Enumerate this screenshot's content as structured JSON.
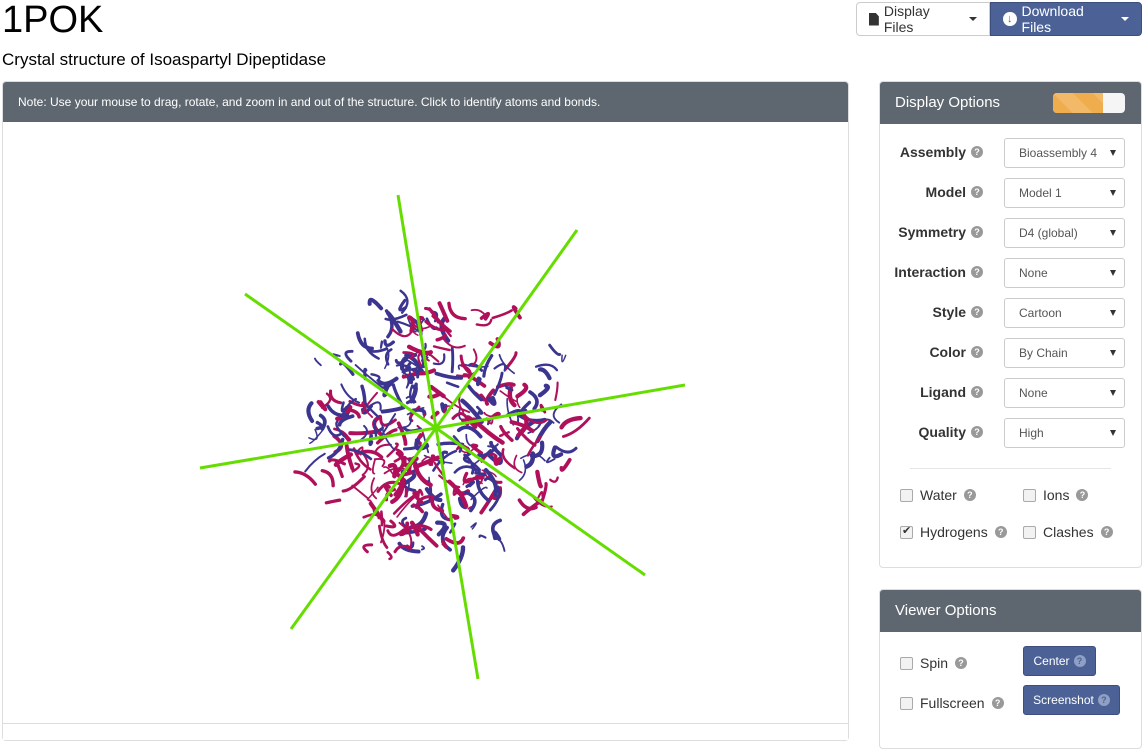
{
  "header": {
    "title": "1POK",
    "subtitle": "Crystal structure of Isoaspartyl Dipeptidase",
    "display_files_label": "Display Files",
    "download_files_label": "Download Files"
  },
  "viewer": {
    "note": "Note: Use your mouse to drag, rotate, and zoom in and out of the structure. Click to identify atoms and bonds.",
    "structure_colors": {
      "chain_a": "#3b3590",
      "chain_b": "#b0105a",
      "symmetry_axes": "#66dd00"
    }
  },
  "display_options": {
    "title": "Display Options",
    "loading_progress_percent": 70,
    "rows": [
      {
        "label": "Assembly",
        "value": "Bioassembly 4"
      },
      {
        "label": "Model",
        "value": "Model 1"
      },
      {
        "label": "Symmetry",
        "value": "D4 (global)"
      },
      {
        "label": "Interaction",
        "value": "None"
      },
      {
        "label": "Style",
        "value": "Cartoon"
      },
      {
        "label": "Color",
        "value": "By Chain"
      },
      {
        "label": "Ligand",
        "value": "None"
      },
      {
        "label": "Quality",
        "value": "High"
      }
    ],
    "checkboxes": [
      {
        "label": "Water",
        "checked": false
      },
      {
        "label": "Ions",
        "checked": false
      },
      {
        "label": "Hydrogens",
        "checked": true
      },
      {
        "label": "Clashes",
        "checked": false
      }
    ]
  },
  "viewer_options": {
    "title": "Viewer Options",
    "spin_label": "Spin",
    "fullscreen_label": "Fullscreen",
    "center_label": "Center",
    "screenshot_label": "Screenshot"
  },
  "icons": {
    "help": "?",
    "download": "↓"
  },
  "colors": {
    "panel_header": "#5e6770",
    "primary": "#4c6296",
    "progress": "#f0ad4e"
  }
}
